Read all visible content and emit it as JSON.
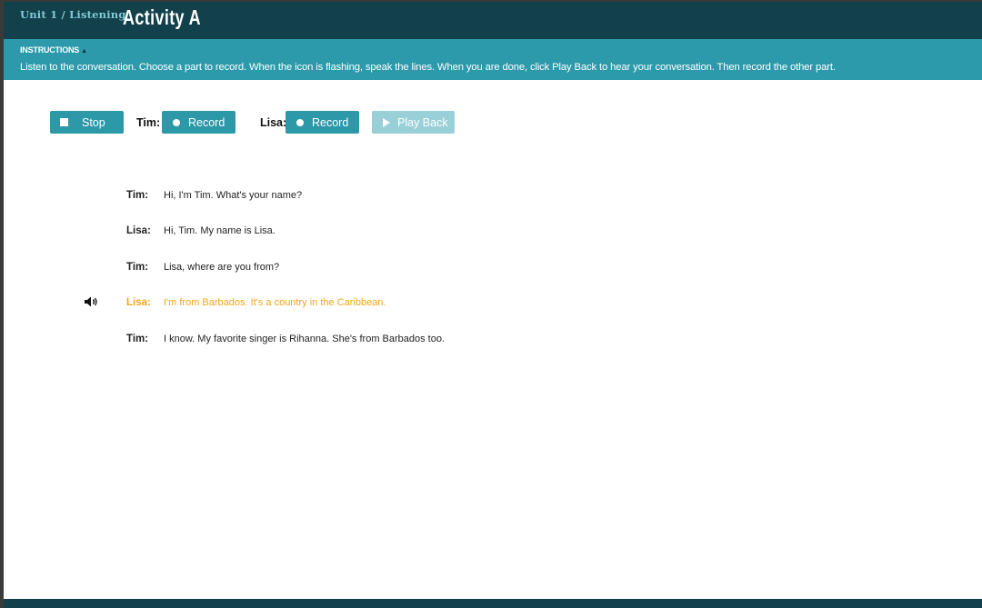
{
  "header": {
    "breadcrumb": "Unit 1 / Listening",
    "title": "Activity A"
  },
  "instructions": {
    "heading": "INSTRUCTIONS",
    "toggle_icon": "triangle-up-icon",
    "text": "Listen to the conversation. Choose a part to record. When the icon is flashing, speak the lines. When you are done, click Play Back to hear your conversation. Then record the other part."
  },
  "controls": {
    "stop_label": "Stop",
    "tim_label": "Tim:",
    "tim_record_label": "Record",
    "lisa_label": "Lisa:",
    "lisa_record_label": "Record",
    "playback_label": "Play Back",
    "playback_enabled": false
  },
  "conversation": [
    {
      "speaker": "Tim:",
      "text": "Hi, I'm Tim. What's your name?",
      "active": false
    },
    {
      "speaker": "Lisa:",
      "text": "Hi, Tim. My name is Lisa.",
      "active": false
    },
    {
      "speaker": "Tim:",
      "text": "Lisa, where are you from?",
      "active": false
    },
    {
      "speaker": "Lisa:",
      "text": "I'm from Barbados. It's a country in the Caribbean.",
      "active": true
    },
    {
      "speaker": "Tim:",
      "text": "I know. My favorite singer is Rihanna. She's from Barbados too.",
      "active": false
    }
  ],
  "colors": {
    "header_bg": "#12414b",
    "accent": "#2c9aab",
    "active_line": "#f2a519",
    "button_disabled": "#99d0d8"
  }
}
